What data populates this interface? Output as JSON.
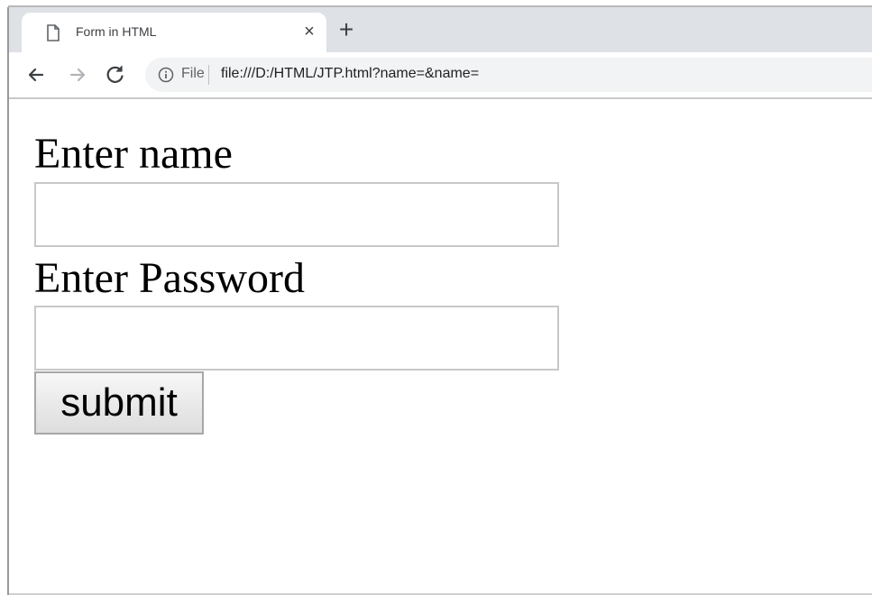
{
  "browser": {
    "tab": {
      "title": "Form in HTML",
      "close_glyph": "×",
      "icon": "document-icon"
    },
    "new_tab_glyph": "+",
    "toolbar": {
      "back_icon": "back-arrow-icon",
      "forward_icon": "forward-arrow-icon",
      "reload_icon": "reload-icon",
      "info_icon": "info-icon",
      "scheme_label": "File",
      "url": "file:///D:/HTML/JTP.html?name=&name="
    }
  },
  "form": {
    "name_label": "Enter name",
    "name_value": "",
    "password_label": "Enter Password",
    "password_value": "",
    "submit_label": "submit"
  }
}
